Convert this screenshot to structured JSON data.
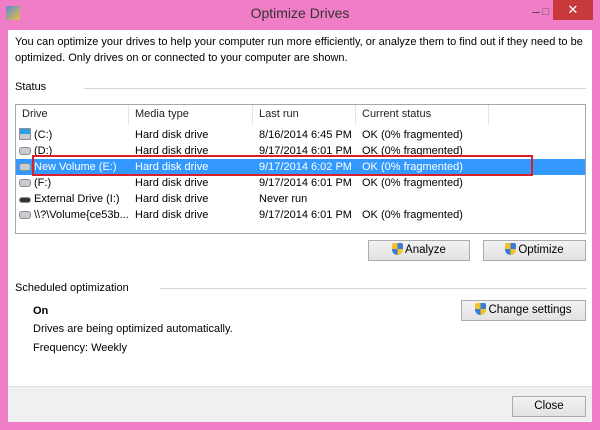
{
  "window": {
    "title": "Optimize Drives",
    "minimize": "–",
    "maximize": "□",
    "close": "✕"
  },
  "description": [
    "You can optimize your drives to help your computer run more efficiently, or analyze them to find out if they need to be",
    "optimized. Only drives on or connected to your computer are shown."
  ],
  "status": {
    "label": "Status",
    "columns": [
      "Drive",
      "Media type",
      "Last run",
      "Current status"
    ],
    "rows": [
      {
        "drive": "(C:)",
        "icon": "system-drive-icon",
        "media": "Hard disk drive",
        "last_run": "8/16/2014 6:45 PM",
        "status": "OK (0% fragmented)"
      },
      {
        "drive": "(D:)",
        "icon": "hard-drive-icon",
        "media": "Hard disk drive",
        "last_run": "9/17/2014 6:01 PM",
        "status": "OK (0% fragmented)"
      },
      {
        "drive": "New Volume (E:)",
        "icon": "hard-drive-icon",
        "media": "Hard disk drive",
        "last_run": "9/17/2014 6:02 PM",
        "status": "OK (0% fragmented)",
        "selected": true
      },
      {
        "drive": "(F:)",
        "icon": "hard-drive-icon",
        "media": "Hard disk drive",
        "last_run": "9/17/2014 6:01 PM",
        "status": "OK (0% fragmented)"
      },
      {
        "drive": "External Drive (I:)",
        "icon": "external-drive-icon",
        "media": "Hard disk drive",
        "last_run": "Never run",
        "status": ""
      },
      {
        "drive": "\\\\?\\Volume{ce53b...",
        "icon": "hard-drive-icon",
        "media": "Hard disk drive",
        "last_run": "9/17/2014 6:01 PM",
        "status": "OK (0% fragmented)"
      }
    ],
    "highlight_color": "#d8202a",
    "selection_color": "#3399ff"
  },
  "buttons": {
    "analyze": "Analyze",
    "optimize": "Optimize",
    "change_settings": "Change settings",
    "close": "Close"
  },
  "scheduled": {
    "label": "Scheduled optimization",
    "state": "On",
    "message": "Drives are being optimized automatically.",
    "frequency": "Frequency: Weekly"
  }
}
